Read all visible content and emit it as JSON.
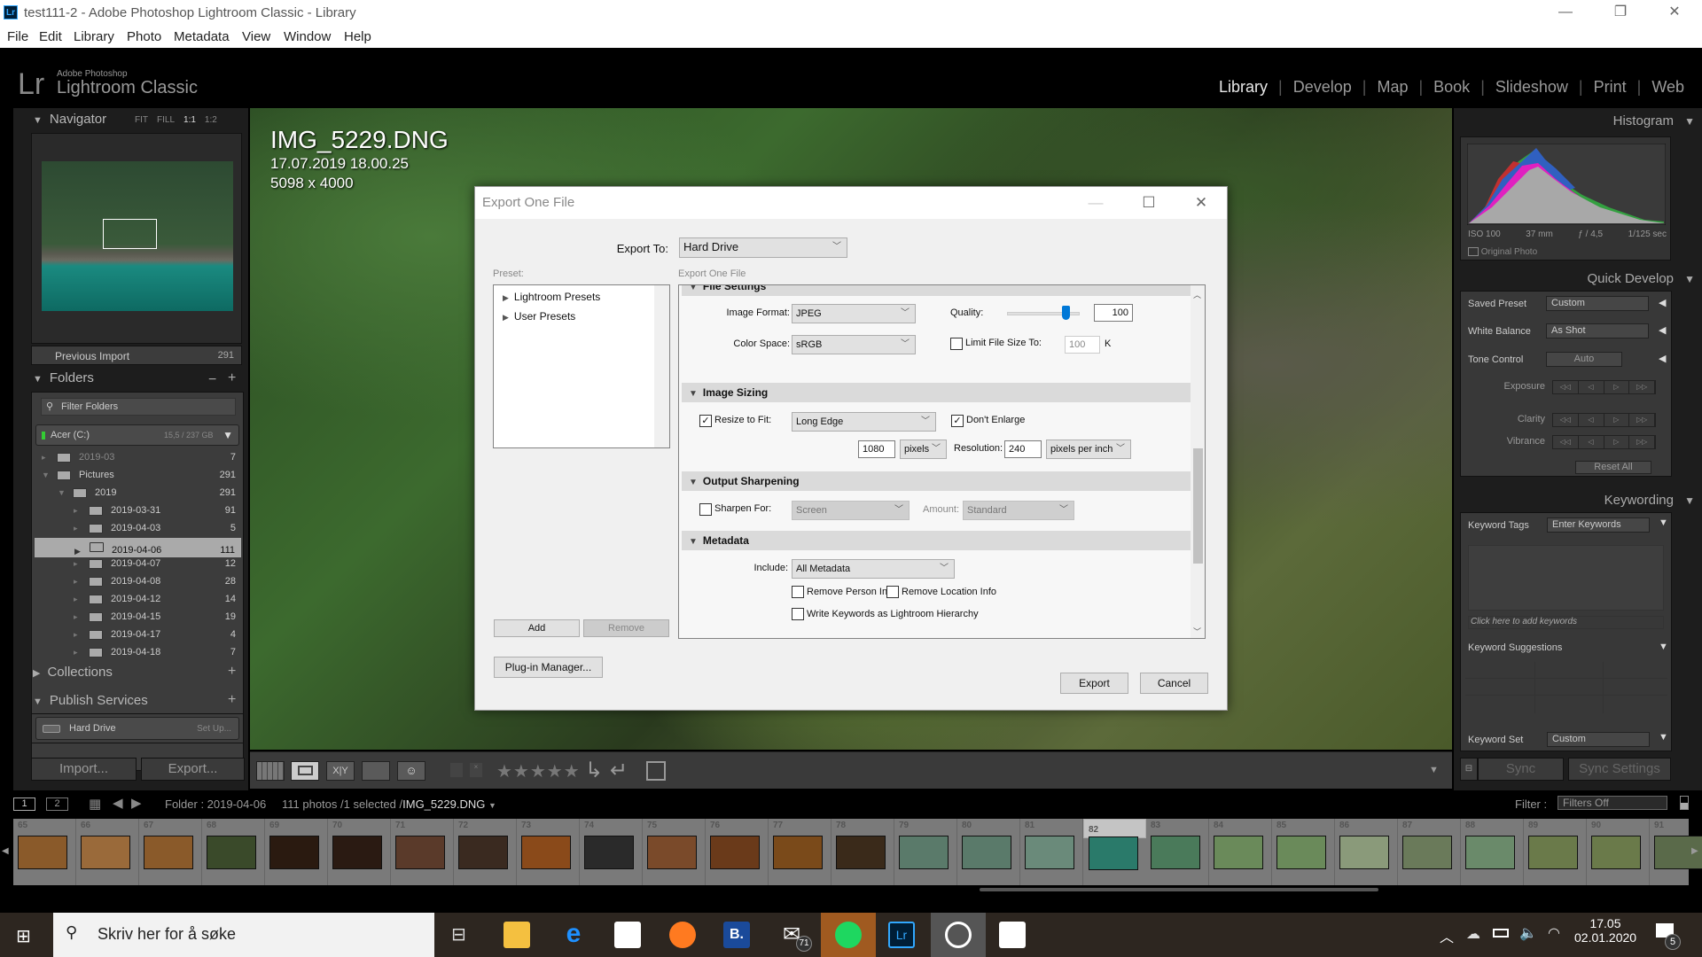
{
  "window": {
    "title": "test111-2 - Adobe Photoshop Lightroom Classic - Library",
    "minimize": "—",
    "restore": "❐",
    "close": "✕"
  },
  "menu": [
    "File",
    "Edit",
    "Library",
    "Photo",
    "Metadata",
    "View",
    "Window",
    "Help"
  ],
  "identity": {
    "logo": "Lr",
    "brand_small": "Adobe Photoshop",
    "brand_big": "Lightroom Classic"
  },
  "modules": [
    {
      "label": "Library",
      "active": true
    },
    {
      "label": "Develop"
    },
    {
      "label": "Map"
    },
    {
      "label": "Book"
    },
    {
      "label": "Slideshow"
    },
    {
      "label": "Print"
    },
    {
      "label": "Web"
    }
  ],
  "navigator": {
    "title": "Navigator",
    "zoom_options": [
      "FIT",
      "FILL",
      "1:1",
      "1:2"
    ],
    "active_zoom": "1:1"
  },
  "catalog": {
    "item": "Previous Import",
    "count": "291"
  },
  "folders": {
    "title": "Folders",
    "minus": "−",
    "plus": "+",
    "filter_placeholder": "Filter Folders",
    "volume": {
      "name": "Acer (C:)",
      "usage": "15,5 / 237 GB"
    },
    "rows": [
      {
        "name": "2019-03",
        "count": "7",
        "level": 0,
        "missing": true
      },
      {
        "name": "Pictures",
        "count": "291",
        "level": 0,
        "expanded": true
      },
      {
        "name": "2019",
        "count": "291",
        "level": 1,
        "expanded": true
      },
      {
        "name": "2019-03-31",
        "count": "91",
        "level": 2
      },
      {
        "name": "2019-04-03",
        "count": "5",
        "level": 2
      },
      {
        "name": "2019-04-06",
        "count": "111",
        "level": 2,
        "selected": true
      },
      {
        "name": "2019-04-07",
        "count": "12",
        "level": 2
      },
      {
        "name": "2019-04-08",
        "count": "28",
        "level": 2
      },
      {
        "name": "2019-04-12",
        "count": "14",
        "level": 2
      },
      {
        "name": "2019-04-15",
        "count": "19",
        "level": 2
      },
      {
        "name": "2019-04-17",
        "count": "4",
        "level": 2
      },
      {
        "name": "2019-04-18",
        "count": "7",
        "level": 2
      }
    ]
  },
  "collections": {
    "title": "Collections",
    "plus": "+"
  },
  "publish": {
    "title": "Publish Services",
    "plus": "+",
    "service": "Hard Drive",
    "setup": "Set Up..."
  },
  "left_buttons": {
    "import": "Import...",
    "export": "Export..."
  },
  "image": {
    "filename": "IMG_5229.DNG",
    "datetime": "17.07.2019 18.00.25",
    "dimensions": "5098 x 4000"
  },
  "histogram": {
    "title": "Histogram",
    "iso": "ISO 100",
    "focal": "37 mm",
    "aperture": "ƒ / 4,5",
    "shutter": "1/125 sec",
    "original_photo": "Original Photo"
  },
  "quick_develop": {
    "title": "Quick Develop",
    "saved_preset": {
      "label": "Saved Preset",
      "value": "Custom"
    },
    "white_balance": {
      "label": "White Balance",
      "value": "As Shot"
    },
    "tone_control": {
      "label": "Tone Control",
      "button": "Auto"
    },
    "steppers": [
      "Exposure",
      "Clarity",
      "Vibrance"
    ],
    "step_glyphs": [
      "◁◁",
      "◁",
      "▷",
      "▷▷"
    ],
    "reset": "Reset All"
  },
  "keywording": {
    "title": "Keywording",
    "tags_label": "Keyword Tags",
    "tags_value": "Enter Keywords",
    "add_placeholder": "Click here to add keywords",
    "suggestions": "Keyword Suggestions",
    "set_label": "Keyword Set",
    "set_value": "Custom"
  },
  "sync": {
    "sync": "Sync",
    "sync_settings": "Sync Settings"
  },
  "toolbar": {
    "stars": "★★★★★",
    "xy": "X|Y"
  },
  "filmstrip_nav": {
    "page1": "1",
    "page2": "2",
    "folder": "Folder : 2019-04-06",
    "count": "111 photos /1 selected /",
    "file": "IMG_5229.DNG",
    "filter_label": "Filter :",
    "filter_value": "Filters Off"
  },
  "filmstrip": {
    "numbers": [
      "65",
      "66",
      "67",
      "68",
      "69",
      "70",
      "71",
      "72",
      "73",
      "74",
      "75",
      "76",
      "77",
      "78",
      "79",
      "80",
      "81",
      "82",
      "83",
      "84",
      "85",
      "86",
      "87",
      "88",
      "89",
      "90",
      "91"
    ],
    "selected": "82",
    "colors": [
      "#8a5a2a",
      "#9a6a3a",
      "#8a5a2a",
      "#3a4a2a",
      "#2a1a10",
      "#2a1a12",
      "#5a3a2a",
      "#3a2a20",
      "#8a4a1a",
      "#2a2a2a",
      "#7a4a2a",
      "#6a3a1a",
      "#7a4a1a",
      "#3a2a1a",
      "#5a7a6a",
      "#5a7a6a",
      "#6a8a7a",
      "#2a7a6a",
      "#4a7a5a",
      "#6a8a5a",
      "#6a8a5a",
      "#8a9a7a",
      "#6a7a5a",
      "#6a8a6a",
      "#6a7a4a",
      "#6a7a4a",
      "#5a6a4a"
    ]
  },
  "export_dialog": {
    "title": "Export One File",
    "export_to_label": "Export To:",
    "export_to_value": "Hard Drive",
    "preset_label": "Preset:",
    "settings_label": "Export One File",
    "presets": [
      "Lightroom Presets",
      "User Presets"
    ],
    "add": "Add",
    "remove": "Remove",
    "plugin": "Plug-in Manager...",
    "file_settings": {
      "title": "File Settings",
      "format_label": "Image Format:",
      "format": "JPEG",
      "quality_label": "Quality:",
      "quality": "100",
      "quality_pct": 100,
      "colorspace_label": "Color Space:",
      "colorspace": "sRGB",
      "limit_label": "Limit File Size To:",
      "limit_checked": false,
      "limit_value": "100",
      "limit_unit": "K"
    },
    "image_sizing": {
      "title": "Image Sizing",
      "resize_label": "Resize to Fit:",
      "resize_checked": true,
      "resize_mode": "Long Edge",
      "dont_enlarge": "Don't Enlarge",
      "dont_enlarge_checked": true,
      "size": "1080",
      "size_unit": "pixels",
      "res_label": "Resolution:",
      "res": "240",
      "res_unit": "pixels per inch"
    },
    "output_sharpening": {
      "title": "Output Sharpening",
      "sharpen_label": "Sharpen For:",
      "sharpen_checked": false,
      "sharpen_for": "Screen",
      "amount_label": "Amount:",
      "amount": "Standard"
    },
    "metadata": {
      "title": "Metadata",
      "include_label": "Include:",
      "include": "All Metadata",
      "remove_person": "Remove Person Info",
      "remove_location": "Remove Location Info",
      "write_keywords": "Write Keywords as Lightroom Hierarchy"
    },
    "export": "Export",
    "cancel": "Cancel"
  },
  "taskbar": {
    "search_placeholder": "Skriv her for å søke",
    "mail_badge": "71",
    "time": "17.05",
    "date": "02.01.2020",
    "notif_badge": "5"
  }
}
